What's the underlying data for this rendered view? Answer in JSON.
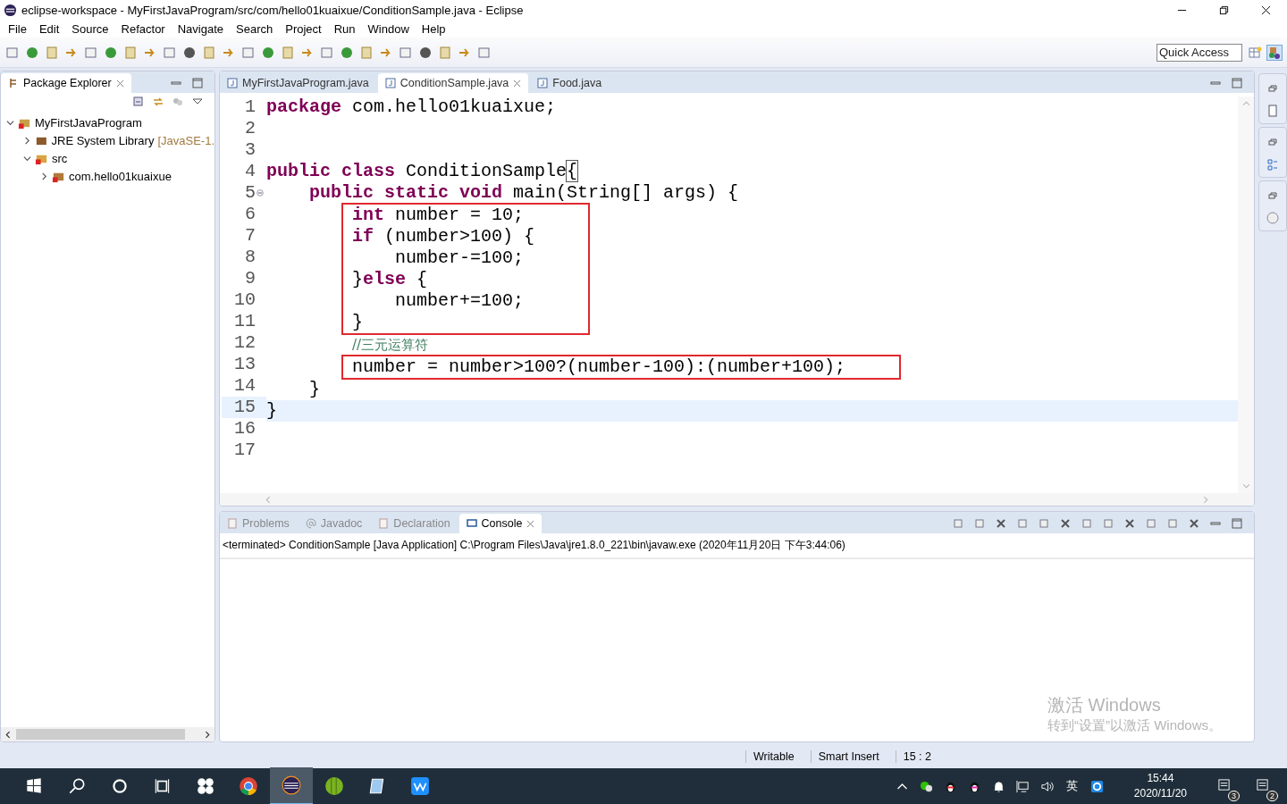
{
  "window": {
    "title": "eclipse-workspace - MyFirstJavaProgram/src/com/hello01kuaixue/ConditionSample.java - Eclipse"
  },
  "menu": [
    "File",
    "Edit",
    "Source",
    "Refactor",
    "Navigate",
    "Search",
    "Project",
    "Run",
    "Window",
    "Help"
  ],
  "quick_access": {
    "placeholder": "Quick Access"
  },
  "package_explorer": {
    "title": "Package Explorer",
    "tree": [
      {
        "label": "MyFirstJavaProgram",
        "kind": "project",
        "expanded": true,
        "children": [
          {
            "label": "JRE System Library",
            "suffix": "[JavaSE-1.",
            "kind": "library",
            "expanded": false
          },
          {
            "label": "src",
            "kind": "folder",
            "expanded": true,
            "children": [
              {
                "label": "com.hello01kuaixue",
                "kind": "package",
                "expanded": false
              }
            ]
          }
        ]
      }
    ]
  },
  "editor": {
    "tabs": [
      {
        "label": "MyFirstJavaProgram.java",
        "selected": false
      },
      {
        "label": "ConditionSample.java",
        "selected": true
      },
      {
        "label": "Food.java",
        "selected": false
      }
    ],
    "lines": [
      {
        "number": "1",
        "tokens": [
          {
            "kind": "keyword",
            "text": "package"
          },
          {
            "kind": "plain",
            "text": " com.hello01kuaixue;"
          }
        ]
      },
      {
        "number": "2"
      },
      {
        "number": "3"
      },
      {
        "number": "4",
        "tokens": [
          {
            "kind": "keyword",
            "text": "public "
          },
          {
            "kind": "keyword",
            "text": "class "
          },
          {
            "kind": "plain",
            "text": "ConditionSample"
          },
          {
            "kind": "bracket",
            "text": "{"
          }
        ],
        "children": [
          {
            "number": "5",
            "fold": true,
            "tokens": [
              {
                "kind": "keyword",
                "text": "public "
              },
              {
                "kind": "keyword",
                "text": "static "
              },
              {
                "kind": "keyword",
                "text": "void "
              },
              {
                "kind": "plain",
                "text": "main(String[] args) {"
              }
            ],
            "children": [
              {
                "kind": "box",
                "children": [
                  {
                    "number": "6",
                    "tokens": [
                      {
                        "kind": "keyword",
                        "text": "int"
                      },
                      {
                        "kind": "plain",
                        "text": " number = 10;"
                      }
                    ]
                  },
                  {
                    "number": "7",
                    "tokens": [
                      {
                        "kind": "keyword",
                        "text": "if"
                      },
                      {
                        "kind": "plain",
                        "text": " (number>100) {"
                      }
                    ],
                    "children": [
                      {
                        "number": "8",
                        "tokens": [
                          {
                            "kind": "plain",
                            "text": "number-=100;"
                          }
                        ]
                      }
                    ]
                  },
                  {
                    "number": "9",
                    "tokens": [
                      {
                        "kind": "plain",
                        "text": "}"
                      },
                      {
                        "kind": "keyword",
                        "text": "else"
                      },
                      {
                        "kind": "plain",
                        "text": " {"
                      }
                    ],
                    "children": [
                      {
                        "number": "10",
                        "tokens": [
                          {
                            "kind": "plain",
                            "text": "number+=100;"
                          }
                        ]
                      }
                    ]
                  },
                  {
                    "number": "11",
                    "tokens": [
                      {
                        "kind": "plain",
                        "text": "}"
                      }
                    ]
                  }
                ]
              },
              {
                "number": "12",
                "tokens": [
                  {
                    "kind": "comment",
                    "text": "//三元运算符"
                  }
                ]
              },
              {
                "kind": "box",
                "children": [
                  {
                    "number": "13",
                    "tokens": [
                      {
                        "kind": "plain",
                        "text": "number = number>100?(number-100):(number+100);"
                      }
                    ]
                  }
                ]
              }
            ]
          },
          {
            "number": "14",
            "tokens": [
              {
                "kind": "plain",
                "text": "}"
              }
            ]
          }
        ]
      },
      {
        "number": "15",
        "current": true,
        "tokens": [
          {
            "kind": "plain",
            "text": "}"
          }
        ]
      },
      {
        "number": "16"
      },
      {
        "number": "17"
      }
    ]
  },
  "console": {
    "tabs": [
      {
        "label": "Problems",
        "kind": "problems",
        "selected": false
      },
      {
        "label": "Javadoc",
        "kind": "javadoc",
        "selected": false
      },
      {
        "label": "Declaration",
        "kind": "declaration",
        "selected": false
      },
      {
        "label": "Console",
        "kind": "console",
        "selected": true
      }
    ],
    "status": "<terminated> ConditionSample [Java Application] C:\\Program Files\\Java\\jre1.8.0_221\\bin\\javaw.exe (2020年11月20日 下午3:44:06)"
  },
  "activation": {
    "title": "激活 Windows",
    "subtitle": "转到“设置”以激活 Windows。"
  },
  "status_bar": [
    "Writable",
    "Smart Insert",
    "15 : 2"
  ],
  "taskbar": {
    "input_method": "英",
    "time": "15:44",
    "date": "2020/11/20",
    "badges": [
      "3",
      "2"
    ]
  }
}
